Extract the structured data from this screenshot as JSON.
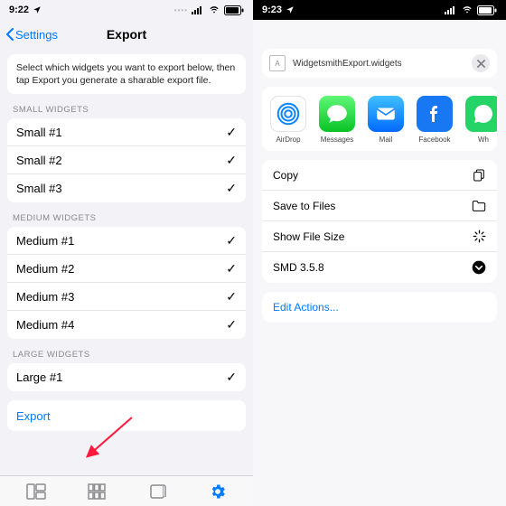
{
  "left": {
    "status_time": "9:22",
    "nav_back": "Settings",
    "nav_title": "Export",
    "intro": "Select which widgets you want to export below, then tap Export you generate a sharable export file.",
    "section_small": "SMALL WIDGETS",
    "small": [
      "Small #1",
      "Small #2",
      "Small #3"
    ],
    "section_medium": "MEDIUM WIDGETS",
    "medium": [
      "Medium #1",
      "Medium #2",
      "Medium #3",
      "Medium #4"
    ],
    "section_large": "LARGE WIDGETS",
    "large": [
      "Large #1"
    ],
    "export_label": "Export"
  },
  "right": {
    "status_time": "9:23",
    "file_name": "WidgetsmithExport.widgets",
    "apps": [
      {
        "name": "AirDrop"
      },
      {
        "name": "Messages"
      },
      {
        "name": "Mail"
      },
      {
        "name": "Facebook"
      },
      {
        "name": "Wh"
      }
    ],
    "actions": [
      {
        "label": "Copy",
        "icon": "copy"
      },
      {
        "label": "Save to Files",
        "icon": "folder"
      },
      {
        "label": "Show File Size",
        "icon": "loading"
      },
      {
        "label": "SMD 3.5.8",
        "icon": "chevron-down-circle"
      }
    ],
    "edit_actions": "Edit Actions..."
  }
}
